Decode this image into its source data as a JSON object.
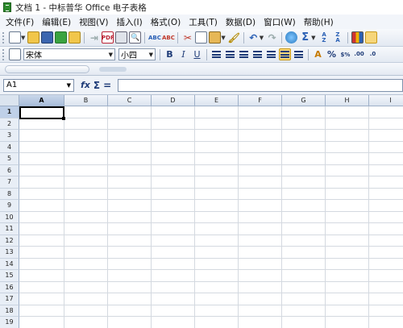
{
  "window": {
    "title": "文档 1 - 中标普华 Office 电子表格"
  },
  "menu": [
    {
      "label": "文件(F)"
    },
    {
      "label": "编辑(E)"
    },
    {
      "label": "视图(V)"
    },
    {
      "label": "插入(I)"
    },
    {
      "label": "格式(O)"
    },
    {
      "label": "工具(T)"
    },
    {
      "label": "数据(D)"
    },
    {
      "label": "窗口(W)"
    },
    {
      "label": "帮助(H)"
    }
  ],
  "format_toolbar": {
    "font_name": "宋体",
    "font_size": "小四",
    "bold_label": "B",
    "italic_label": "I",
    "underline_label": "U",
    "percent_label": "%",
    "currency_label": "$%",
    "decimal_add_label": ".00",
    "decimal_remove_label": ".0"
  },
  "formula_bar": {
    "cell_reference": "A1",
    "fx_label": "fx",
    "sum_label": "Σ",
    "equals_label": "=",
    "formula_value": ""
  },
  "sheet": {
    "columns": [
      "A",
      "B",
      "C",
      "D",
      "E",
      "F",
      "G",
      "H",
      "I"
    ],
    "rows": [
      "1",
      "2",
      "3",
      "4",
      "5",
      "6",
      "7",
      "8",
      "9",
      "10",
      "11",
      "12",
      "13",
      "14",
      "15",
      "16",
      "17",
      "18",
      "19"
    ],
    "selected_column": "A",
    "selected_row": "1",
    "active_cell": "A1"
  },
  "colors": {
    "header_bg": "#dbe4ef",
    "selected_header_bg": "#a9bedb",
    "gridline": "#d4d9e0",
    "toolbar_bg": "#e3e9f2"
  }
}
